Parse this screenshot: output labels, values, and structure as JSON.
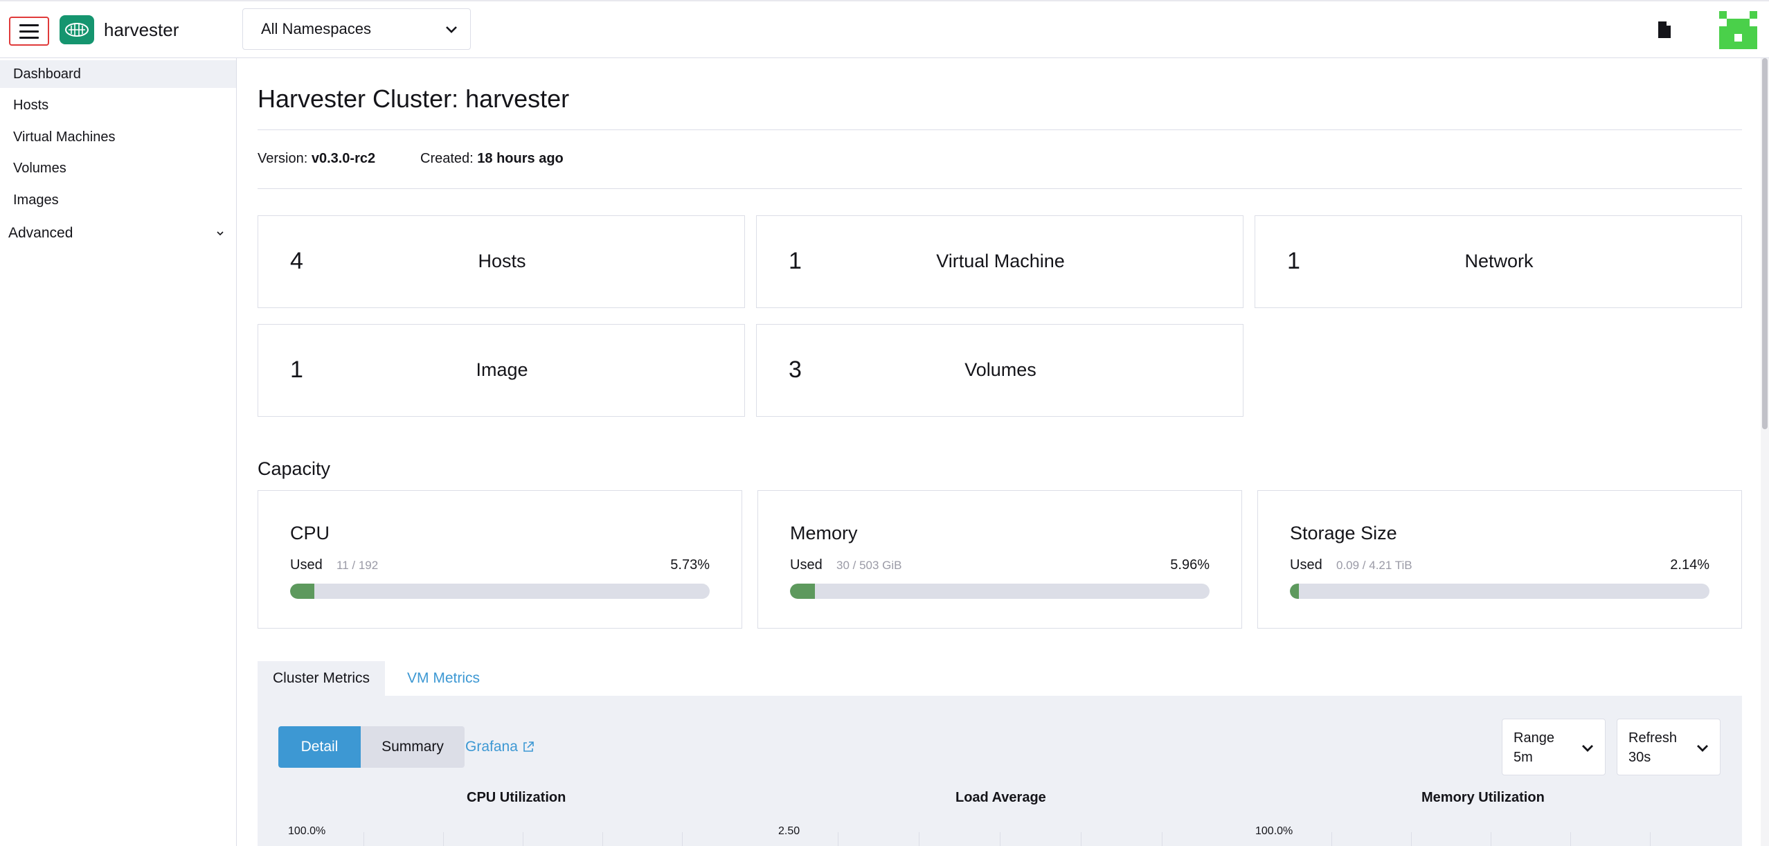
{
  "header": {
    "brand_name": "harvester",
    "namespace_selected": "All Namespaces"
  },
  "sidebar": {
    "items": [
      {
        "label": "Dashboard",
        "active": true
      },
      {
        "label": "Hosts"
      },
      {
        "label": "Virtual Machines"
      },
      {
        "label": "Volumes"
      },
      {
        "label": "Images"
      }
    ],
    "group_label": "Advanced"
  },
  "main": {
    "title": "Harvester Cluster: harvester",
    "version_label": "Version:",
    "version_value": "v0.3.0-rc2",
    "created_label": "Created:",
    "created_value": "18 hours ago",
    "stats": [
      {
        "count": "4",
        "label": "Hosts"
      },
      {
        "count": "1",
        "label": "Virtual Machine"
      },
      {
        "count": "1",
        "label": "Network"
      },
      {
        "count": "1",
        "label": "Image"
      },
      {
        "count": "3",
        "label": "Volumes"
      }
    ],
    "capacity_title": "Capacity",
    "capacity": [
      {
        "title": "CPU",
        "used_label": "Used",
        "detail": "11 / 192",
        "percent": "5.73%",
        "fraction": 0.0573
      },
      {
        "title": "Memory",
        "used_label": "Used",
        "detail": "30 / 503 GiB",
        "percent": "5.96%",
        "fraction": 0.0596
      },
      {
        "title": "Storage Size",
        "used_label": "Used",
        "detail": "0.09 / 4.21 TiB",
        "percent": "2.14%",
        "fraction": 0.0214
      }
    ],
    "tabs": [
      {
        "label": "Cluster Metrics",
        "active": true
      },
      {
        "label": "VM Metrics",
        "active": false
      }
    ],
    "metrics": {
      "detail_label": "Detail",
      "summary_label": "Summary",
      "grafana_label": "Grafana",
      "range_label": "Range",
      "range_value": "5m",
      "refresh_label": "Refresh",
      "refresh_value": "30s",
      "charts": [
        {
          "title": "CPU Utilization",
          "top_value": "100.0%"
        },
        {
          "title": "Load Average",
          "top_value": "2.50"
        },
        {
          "title": "Memory Utilization",
          "top_value": "100.0%"
        }
      ]
    }
  },
  "colors": {
    "accent": "#3d98d3",
    "brand": "#15956f",
    "bar_fill": "#5d995d",
    "highlight_border": "#e03a3a"
  }
}
